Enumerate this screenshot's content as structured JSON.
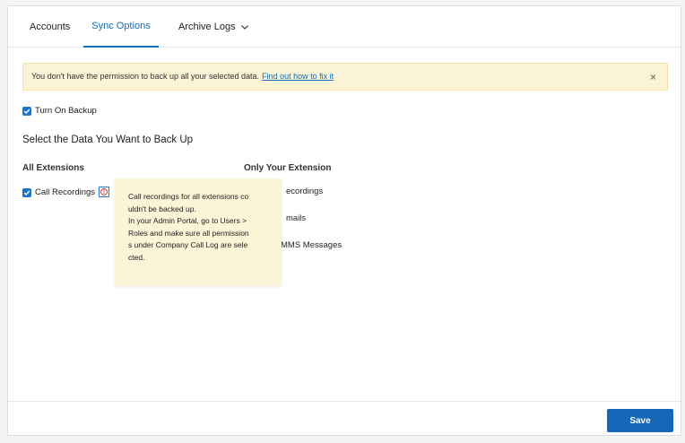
{
  "tabs": [
    {
      "label": "Accounts"
    },
    {
      "label": "Sync Options"
    },
    {
      "label": "Archive Logs"
    }
  ],
  "banner": {
    "message": "You don't have the permission to back up all your selected data.",
    "link": "Find out how to fix it",
    "close": "×"
  },
  "backup_toggle": {
    "label": "Turn On Backup",
    "checked": true
  },
  "section_title": "Select the Data You Want to Back Up",
  "all_extensions": {
    "header": "All Extensions",
    "items": [
      {
        "label": "Call Recordings",
        "checked": true
      }
    ]
  },
  "only_your_extension": {
    "header": "Only Your Extension",
    "items": [
      {
        "label": "ecordings"
      },
      {
        "label": "mails"
      },
      {
        "label": "MMS Messages"
      }
    ]
  },
  "tooltip": {
    "lines": [
      "Call recordings for all extensions co",
      "uldn't be backed up.",
      "In your Admin Portal, go to Users >",
      "Roles and make sure all permission",
      "s under Company Call Log are sele",
      "cted."
    ]
  },
  "footer": {
    "save_label": "Save"
  },
  "colors": {
    "accent": "#0f6cbd",
    "banner_bg": "#fbf3d6",
    "warning": "#d63b3b",
    "button": "#1565b8"
  },
  "icons": {
    "checkbox": "checkmark-icon",
    "warning": "warning-circle-icon",
    "close": "close-icon",
    "dropdown": "chevron-down-icon"
  }
}
